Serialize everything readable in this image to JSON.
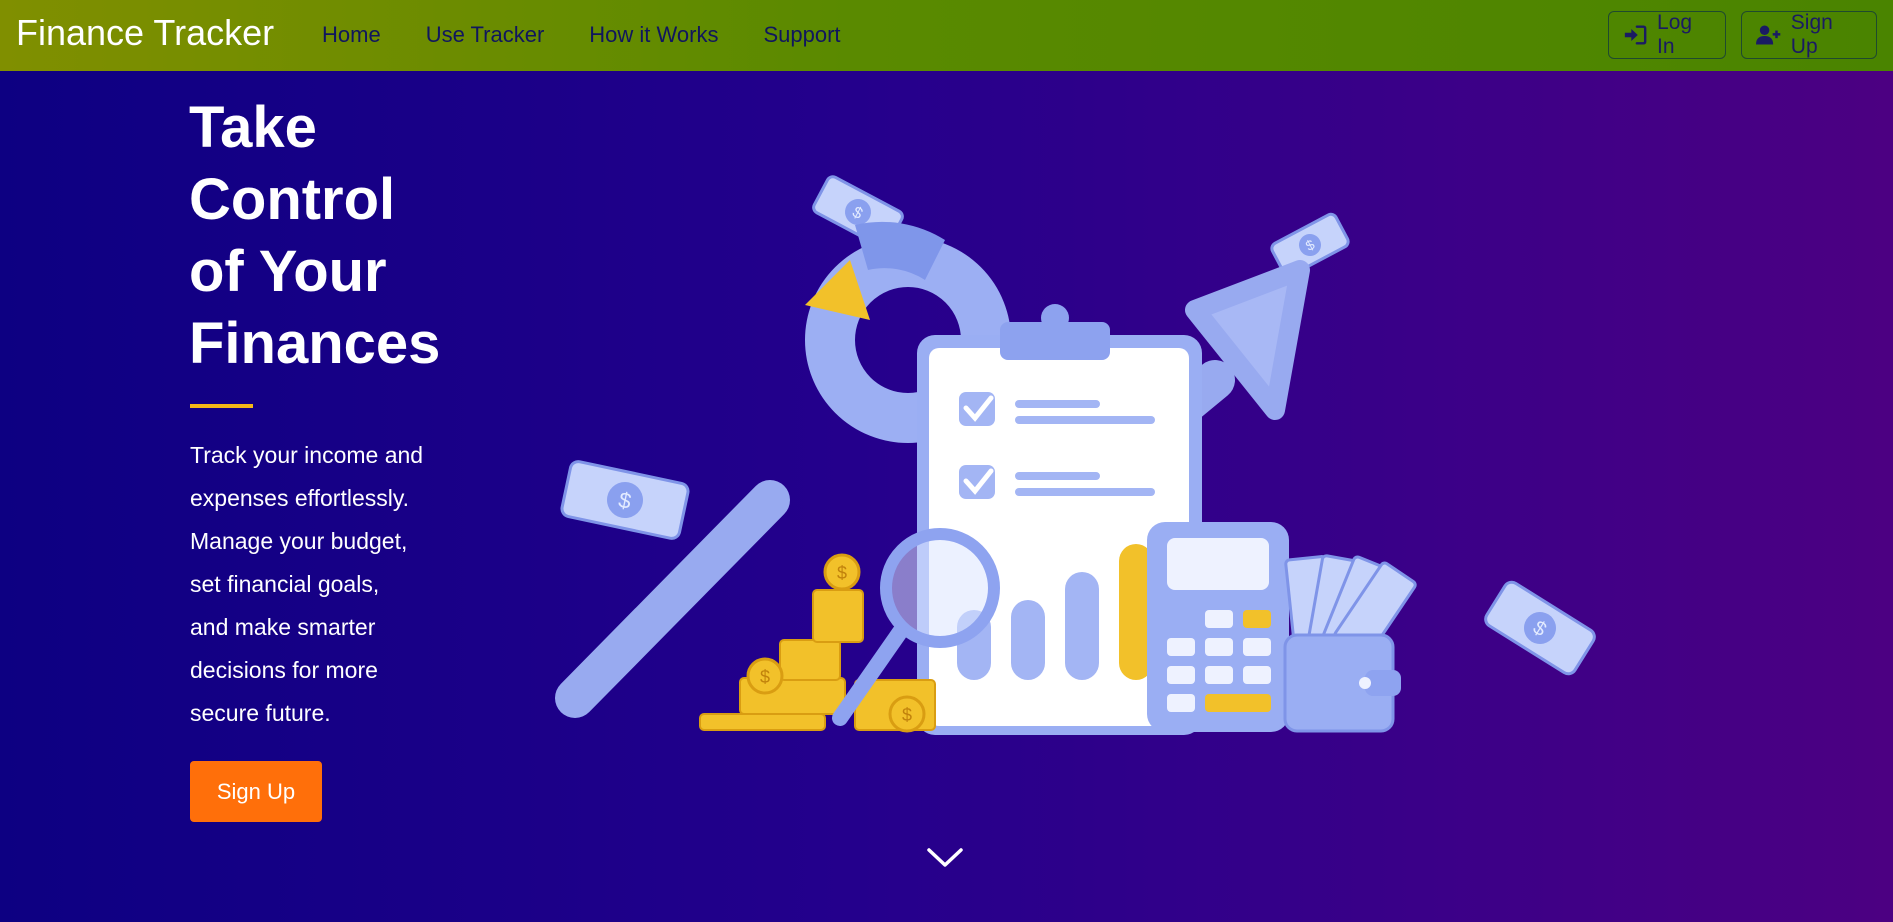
{
  "navbar": {
    "brand": "Finance Tracker",
    "links": [
      "Home",
      "Use Tracker",
      "How it Works",
      "Support"
    ],
    "login_label": "Log In",
    "signup_label": "Sign Up",
    "login_icon": "sign-in-icon",
    "signup_icon": "user-plus-icon"
  },
  "hero": {
    "title_lines": [
      "Take",
      "Control",
      "of Your",
      "Finances"
    ],
    "description_lines": [
      "Track your income and",
      "expenses effortlessly.",
      "Manage your budget,",
      "set financial goals,",
      "and make smarter",
      "decisions for more",
      "secure future."
    ],
    "cta_label": "Sign Up",
    "scroll_icon": "chevron-down-icon",
    "illustration": "finance-illustration"
  },
  "colors": {
    "navbar_start": "#808f00",
    "navbar_end": "#4a8400",
    "hero_start": "#0d0082",
    "hero_end": "#4c0082",
    "accent": "#f4b817",
    "cta": "#ff6f0a",
    "illustration_blue": "#9fb1f3",
    "coin_gold": "#f2c12a"
  }
}
